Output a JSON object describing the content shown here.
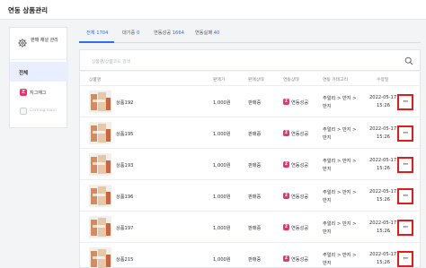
{
  "window": {
    "title": "연동 상품관리"
  },
  "sidebar": {
    "header_label": "판매 채널 관리",
    "all_label": "전체",
    "channels": [
      {
        "label": "지그재그",
        "icon": "zigzag-logo",
        "status": "active"
      }
    ],
    "coming_soon": "Coming soon"
  },
  "tabs": [
    {
      "label": "전체",
      "count": "1704",
      "active": true
    },
    {
      "label": "대기중",
      "count": "0",
      "active": false
    },
    {
      "label": "연동성공",
      "count": "1664",
      "active": false
    },
    {
      "label": "연동실패",
      "count": "40",
      "active": false
    }
  ],
  "search": {
    "placeholder": "상품명/상품코드 검색"
  },
  "table": {
    "headers": [
      "상품명",
      "판매가",
      "판매상태",
      "연동상태",
      "연동 카테고리",
      "수정일"
    ],
    "rows": [
      {
        "name": "상품192",
        "price": "1,000원",
        "sale_status": "판매중",
        "link_status": "연동성공",
        "category_1": "주얼리 > 반지 >",
        "category_2": "반지",
        "date": "2022-05-17",
        "time": "15:26"
      },
      {
        "name": "상품195",
        "price": "1,000원",
        "sale_status": "판매중",
        "link_status": "연동성공",
        "category_1": "주얼리 > 반지 >",
        "category_2": "반지",
        "date": "2022-05-17",
        "time": "15:26"
      },
      {
        "name": "상품193",
        "price": "1,000원",
        "sale_status": "판매중",
        "link_status": "연동성공",
        "category_1": "주얼리 > 반지 >",
        "category_2": "반지",
        "date": "2022-05-17",
        "time": "15:26"
      },
      {
        "name": "상품196",
        "price": "1,000원",
        "sale_status": "판매중",
        "link_status": "연동성공",
        "category_1": "주얼리 > 반지 >",
        "category_2": "반지",
        "date": "2022-05-17",
        "time": "15:26"
      },
      {
        "name": "상품197",
        "price": "1,000원",
        "sale_status": "판매중",
        "link_status": "연동성공",
        "category_1": "주얼리 > 반지 >",
        "category_2": "반지",
        "date": "2022-05-17",
        "time": "15:26"
      },
      {
        "name": "상품215",
        "price": "1,000원",
        "sale_status": "판매중",
        "link_status": "연동성공",
        "category_1": "주얼리 > 반지 >",
        "category_2": "반지",
        "date": "2022-05-17",
        "time": "15:26"
      }
    ],
    "more_label": "···"
  },
  "colors": {
    "accent": "#2f6ff0",
    "channel_badge": "#e8336c",
    "highlight_box": "#e31b1b"
  }
}
